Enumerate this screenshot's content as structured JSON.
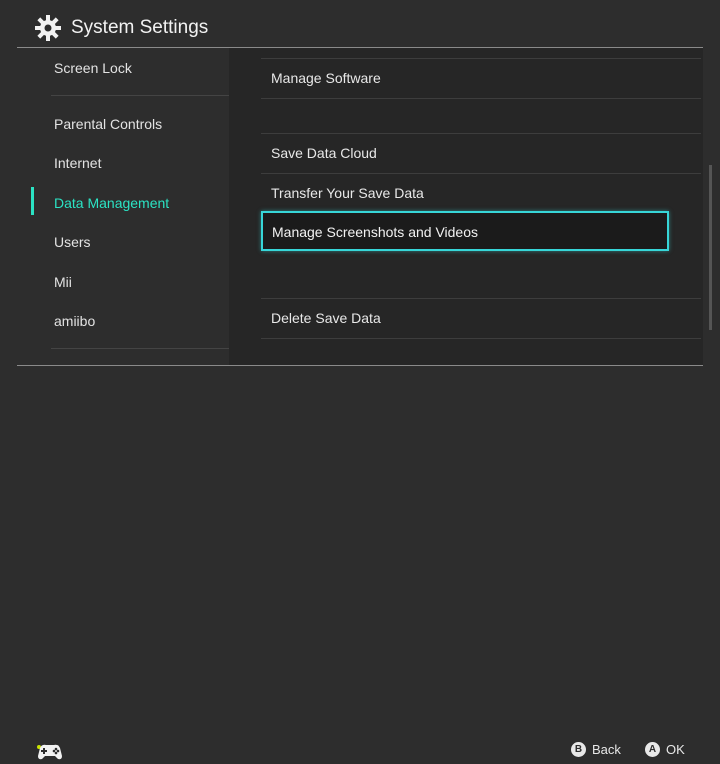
{
  "header": {
    "title": "System Settings",
    "icon": "gear-icon"
  },
  "sidebar": {
    "items": [
      {
        "label": "Screen Lock"
      },
      {
        "label": "Parental Controls"
      },
      {
        "label": "Internet"
      },
      {
        "label": "Data Management",
        "active": true
      },
      {
        "label": "Users"
      },
      {
        "label": "Mii"
      },
      {
        "label": "amiibo"
      }
    ]
  },
  "content": {
    "rows": [
      {
        "label": "Manage Software"
      },
      {
        "label": "Save Data Cloud"
      },
      {
        "label": "Transfer Your Save Data"
      },
      {
        "label": "Manage Screenshots and Videos",
        "selected": true
      },
      {
        "label": "Delete Save Data"
      }
    ]
  },
  "footer": {
    "back": {
      "button": "B",
      "label": "Back"
    },
    "ok": {
      "button": "A",
      "label": "OK"
    },
    "controller_icon": "controller-icon"
  },
  "colors": {
    "accent": "#2be3c4",
    "selection_border": "#37d6d8",
    "background": "#2d2d2d"
  }
}
